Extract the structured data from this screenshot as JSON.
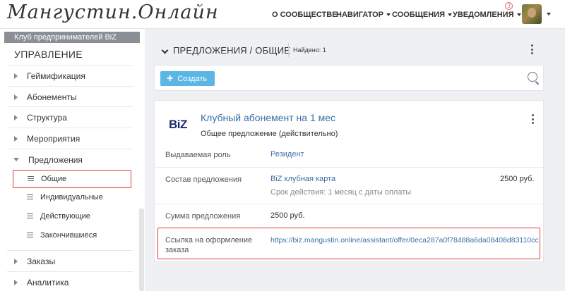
{
  "header": {
    "logo_text": "Мангустин.Онлайн",
    "nav": [
      {
        "label": "О СООБЩЕСТВЕ",
        "has_caret": false
      },
      {
        "label": "НАВИГАТОР",
        "has_caret": true
      },
      {
        "label": "СООБЩЕНИЯ",
        "has_caret": true
      },
      {
        "label": "УВЕДОМЛЕНИЯ",
        "has_caret": true
      }
    ],
    "notifications_count": "3",
    "icons": {
      "avatar": "user-avatar",
      "avatar_menu": "chevron-down-icon"
    }
  },
  "sidebar": {
    "club_name": "Клуб предпринимателей BiZ",
    "section_title": "УПРАВЛЕНИЕ",
    "items": [
      {
        "label": "Геймификация"
      },
      {
        "label": "Абонементы"
      },
      {
        "label": "Структура"
      },
      {
        "label": "Мероприятия"
      },
      {
        "label": "Предложения",
        "expanded": true
      }
    ],
    "sub_items": [
      {
        "label": "Общие",
        "active": true
      },
      {
        "label": "Индивидуальные"
      },
      {
        "label": "Действующие"
      },
      {
        "label": "Закончившиеся"
      }
    ],
    "bottom_items": [
      {
        "label": "Заказы"
      },
      {
        "label": "Аналитика"
      }
    ]
  },
  "main": {
    "title": "ПРЕДЛОЖЕНИЯ / ОБЩИЕ",
    "found_label": "Найдено: 1",
    "create_button_label": "Создать",
    "card": {
      "logo_text": "BiZ",
      "title": "Клубный абонемент на 1 мес",
      "subtitle": "Общее предложение  (действительно)",
      "role_label": "Выдаваемая роль",
      "role_value": "Резидент",
      "composition_label": "Состав предложения",
      "composition_item": "BiZ клубная карта",
      "composition_price": "2500 руб.",
      "composition_term": "Срок действия: 1 месяц с даты оплаты",
      "sum_label": "Сумма предложения",
      "sum_value": "2500 руб.",
      "link_label_line1": "Ссылка на оформление",
      "link_label_line2": "заказа",
      "link_value": "https://biz.mangustin.online/assistant/offer/0eca287a0f78488a6da08408d83110cc"
    },
    "highlight_color": "#e53935",
    "accent_color": "#5bb6e6"
  }
}
